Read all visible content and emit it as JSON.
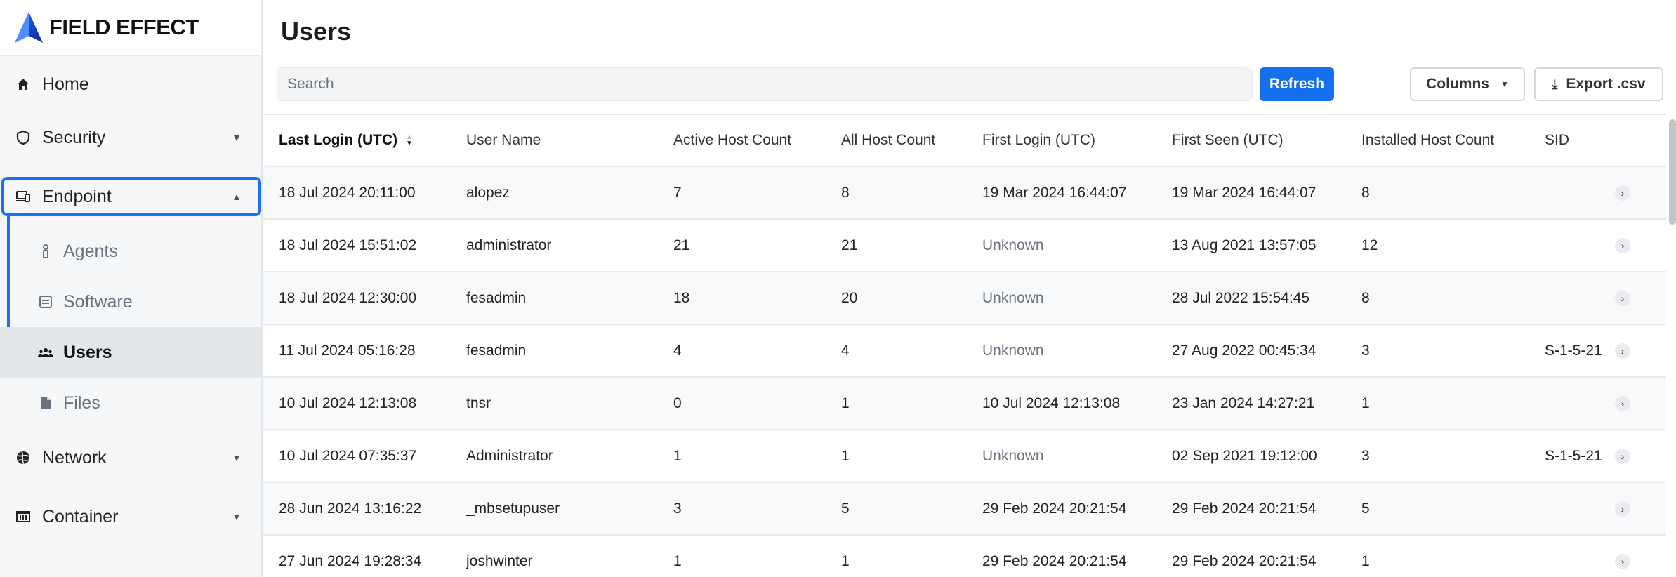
{
  "brand": {
    "name": "FIELD EFFECT"
  },
  "nav": {
    "home": "Home",
    "security": "Security",
    "endpoint": "Endpoint",
    "agents": "Agents",
    "software": "Software",
    "users": "Users",
    "files": "Files",
    "network": "Network",
    "container": "Container"
  },
  "page": {
    "title": "Users"
  },
  "toolbar": {
    "search_placeholder": "Search",
    "refresh_label": "Refresh",
    "columns_label": "Columns",
    "export_label": "Export .csv"
  },
  "table": {
    "headers": [
      "Last Login (UTC)",
      "User Name",
      "Active Host Count",
      "All Host Count",
      "First Login (UTC)",
      "First Seen (UTC)",
      "Installed Host Count",
      "SID"
    ],
    "rows": [
      [
        "18 Jul 2024 20:11:00",
        "alopez",
        "7",
        "8",
        "19 Mar 2024 16:44:07",
        "19 Mar 2024 16:44:07",
        "8",
        ""
      ],
      [
        "18 Jul 2024 15:51:02",
        "administrator",
        "21",
        "21",
        "Unknown",
        "13 Aug 2021 13:57:05",
        "12",
        ""
      ],
      [
        "18 Jul 2024 12:30:00",
        "fesadmin",
        "18",
        "20",
        "Unknown",
        "28 Jul 2022 15:54:45",
        "8",
        ""
      ],
      [
        "11 Jul 2024 05:16:28",
        "fesadmin",
        "4",
        "4",
        "Unknown",
        "27 Aug 2022 00:45:34",
        "3",
        "S-1-5-21"
      ],
      [
        "10 Jul 2024 12:13:08",
        "tnsr",
        "0",
        "1",
        "10 Jul 2024 12:13:08",
        "23 Jan 2024 14:27:21",
        "1",
        ""
      ],
      [
        "10 Jul 2024 07:35:37",
        "Administrator",
        "1",
        "1",
        "Unknown",
        "02 Sep 2021 19:12:00",
        "3",
        "S-1-5-21"
      ],
      [
        "28 Jun 2024 13:16:22",
        "_mbsetupuser",
        "3",
        "5",
        "29 Feb 2024 20:21:54",
        "29 Feb 2024 20:21:54",
        "5",
        ""
      ],
      [
        "27 Jun 2024 19:28:34",
        "joshwinter",
        "1",
        "1",
        "29 Feb 2024 20:21:54",
        "29 Feb 2024 20:21:54",
        "1",
        ""
      ]
    ]
  },
  "colors": {
    "accent": "#1570ef",
    "highlight": "#1a73e8"
  }
}
